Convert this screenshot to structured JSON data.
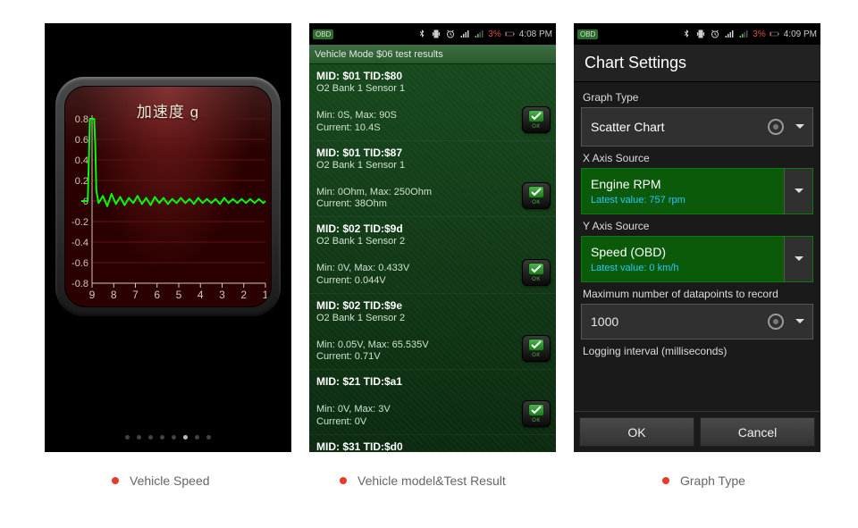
{
  "captions": {
    "c1": "Vehicle Speed",
    "c2": "Vehicle model&Test Result",
    "c3": "Graph Type"
  },
  "phone1": {
    "gauge_title": "加速度 g",
    "y_ticks": [
      "0.8",
      "0.6",
      "0.4",
      "0.2",
      "0",
      "-0.2",
      "-0.4",
      "-0.6",
      "-0.8"
    ],
    "x_ticks": [
      "9",
      "8",
      "7",
      "6",
      "5",
      "4",
      "3",
      "2",
      "1"
    ],
    "page_index": 5,
    "page_count": 8
  },
  "chart_data": {
    "type": "line",
    "title": "加速度 g",
    "xlabel": "",
    "ylabel": "",
    "x_reversed": true,
    "xlim": [
      1,
      9
    ],
    "ylim": [
      -0.8,
      0.8
    ],
    "x": [
      9.5,
      9.2,
      9.1,
      9.0,
      8.9,
      8.85,
      8.8,
      8.7,
      8.5,
      8.3,
      8.1,
      7.9,
      7.7,
      7.5,
      7.3,
      7.1,
      6.9,
      6.7,
      6.5,
      6.3,
      6.1,
      5.9,
      5.7,
      5.5,
      5.3,
      5.1,
      4.9,
      4.7,
      4.5,
      4.3,
      4.1,
      3.9,
      3.7,
      3.5,
      3.3,
      3.1,
      2.9,
      2.7,
      2.5,
      2.3,
      2.1,
      1.9,
      1.7,
      1.5,
      1.3,
      1.1,
      1.0
    ],
    "y": [
      0.0,
      0.0,
      0.8,
      0.8,
      0.8,
      0.55,
      0.1,
      -0.02,
      0.05,
      -0.05,
      0.07,
      -0.03,
      0.04,
      -0.04,
      0.03,
      -0.02,
      0.05,
      -0.03,
      0.03,
      -0.04,
      0.04,
      -0.02,
      0.03,
      -0.03,
      0.02,
      -0.02,
      0.03,
      -0.02,
      0.02,
      -0.03,
      0.03,
      -0.02,
      0.02,
      -0.02,
      0.02,
      -0.03,
      0.03,
      -0.02,
      0.02,
      -0.02,
      0.02,
      -0.02,
      0.02,
      -0.02,
      0.02,
      -0.02,
      0.0
    ],
    "series_color": "#00ff00"
  },
  "phone2": {
    "statusbar": {
      "battery": "3%",
      "time": "4:08 PM",
      "badge": "OBD"
    },
    "title": "Vehicle Mode $06 test results",
    "items": [
      {
        "mid": "MID: $01 TID:$80",
        "sensor": "O2 Bank 1 Sensor 1",
        "vals1": "Min: 0S, Max: 90S",
        "vals2": "Current: 10.4S"
      },
      {
        "mid": "MID: $01 TID:$87",
        "sensor": "O2 Bank 1 Sensor 1",
        "vals1": "Min: 0Ohm, Max: 250Ohm",
        "vals2": "Current: 38Ohm"
      },
      {
        "mid": "MID: $02 TID:$9d",
        "sensor": "O2 Bank 1 Sensor 2",
        "vals1": "Min: 0V, Max: 0.433V",
        "vals2": "Current: 0.044V"
      },
      {
        "mid": "MID: $02 TID:$9e",
        "sensor": "O2 Bank 1 Sensor 2",
        "vals1": "Min: 0.05V, Max: 65.535V",
        "vals2": "Current: 0.71V"
      },
      {
        "mid": "MID: $21 TID:$a1",
        "sensor": "",
        "vals1": "Min: 0V, Max: 3V",
        "vals2": "Current: 0V"
      },
      {
        "mid": "MID: $31 TID:$d0",
        "sensor": "",
        "vals1": "",
        "vals2": ""
      }
    ],
    "ok_label": "OK"
  },
  "phone3": {
    "statusbar": {
      "battery": "3%",
      "time": "4:09 PM",
      "badge": "OBD"
    },
    "header": "Chart Settings",
    "labels": {
      "graph_type": "Graph Type",
      "x_source": "X Axis Source",
      "y_source": "Y Axis Source",
      "max_points": "Maximum number of datapoints to record",
      "interval": "Logging interval (milliseconds)"
    },
    "graph_type_value": "Scatter Chart",
    "x_source": {
      "name": "Engine RPM",
      "latest": "Latest value: 757 rpm"
    },
    "y_source": {
      "name": "Speed (OBD)",
      "latest": "Latest value: 0 km/h"
    },
    "max_points_value": "1000",
    "buttons": {
      "ok": "OK",
      "cancel": "Cancel"
    }
  }
}
